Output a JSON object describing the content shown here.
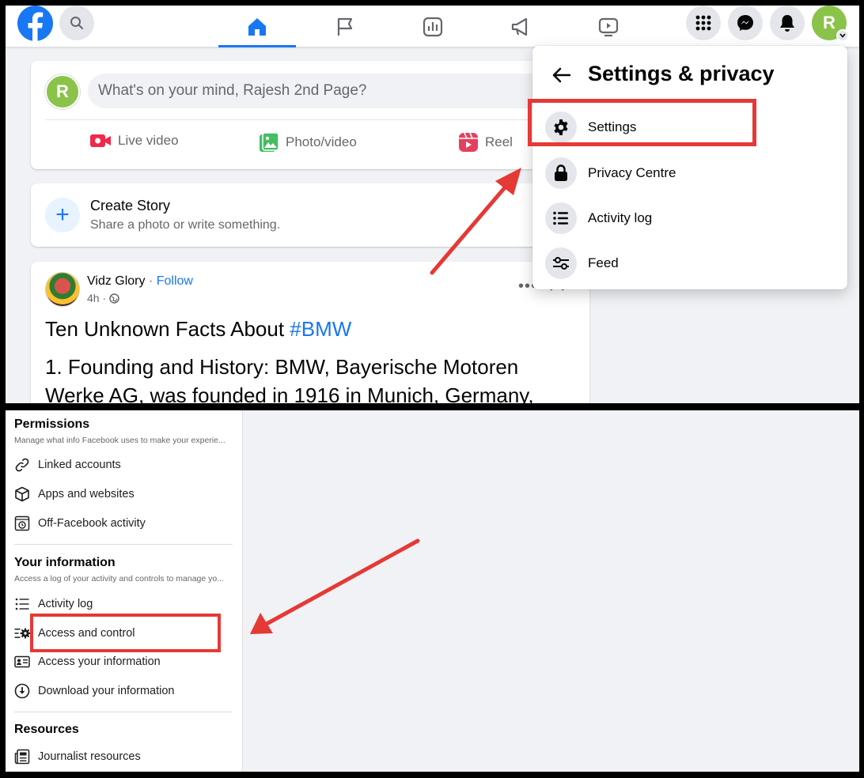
{
  "top_panel": {
    "topbar": {
      "nav_tabs": [
        "home",
        "pages",
        "insights",
        "ads",
        "watch"
      ],
      "avatar_letter": "R",
      "colors": {
        "brand": "#1877f2",
        "avatar": "#8bc34a"
      }
    },
    "composer": {
      "avatar_letter": "R",
      "placeholder": "What's on your mind, Rajesh 2nd Page?",
      "actions": [
        {
          "label": "Live video",
          "icon": "live-video-icon"
        },
        {
          "label": "Photo/video",
          "icon": "photo-video-icon"
        },
        {
          "label": "Reel",
          "icon": "reel-icon"
        }
      ]
    },
    "story": {
      "title": "Create Story",
      "subtitle": "Share a photo or write something."
    },
    "post": {
      "author": "Vidz Glory",
      "separator": " · ",
      "follow": "Follow",
      "time": "4h ·",
      "title_prefix": "Ten Unknown Facts About ",
      "hashtag": "#BMW",
      "body": "1. Founding and History: BMW, Bayerische Motoren Werke AG, was founded in 1916 in Munich, Germany,"
    },
    "settings_menu": {
      "title": "Settings & privacy",
      "items": [
        {
          "label": "Settings",
          "icon": "gear-icon"
        },
        {
          "label": "Privacy Centre",
          "icon": "lock-icon"
        },
        {
          "label": "Activity log",
          "icon": "list-icon"
        },
        {
          "label": "Feed",
          "icon": "sliders-icon"
        }
      ]
    }
  },
  "bottom_panel": {
    "permissions": {
      "title": "Permissions",
      "description": "Manage what info Facebook uses to make your experie...",
      "items": [
        {
          "label": "Linked accounts",
          "icon": "link-icon"
        },
        {
          "label": "Apps and websites",
          "icon": "cube-icon"
        },
        {
          "label": "Off-Facebook activity",
          "icon": "history-icon"
        }
      ]
    },
    "your_information": {
      "title": "Your information",
      "description": "Access a log of your activity and controls to manage yo...",
      "items": [
        {
          "label": "Activity log",
          "icon": "list-icon"
        },
        {
          "label": "Access and control",
          "icon": "list-gear-icon"
        },
        {
          "label": "Access your information",
          "icon": "id-card-icon"
        },
        {
          "label": "Download your information",
          "icon": "download-icon"
        }
      ]
    },
    "resources": {
      "title": "Resources",
      "items": [
        {
          "label": "Journalist resources",
          "icon": "newspaper-icon"
        }
      ]
    }
  },
  "annotation_color": "#e53935"
}
